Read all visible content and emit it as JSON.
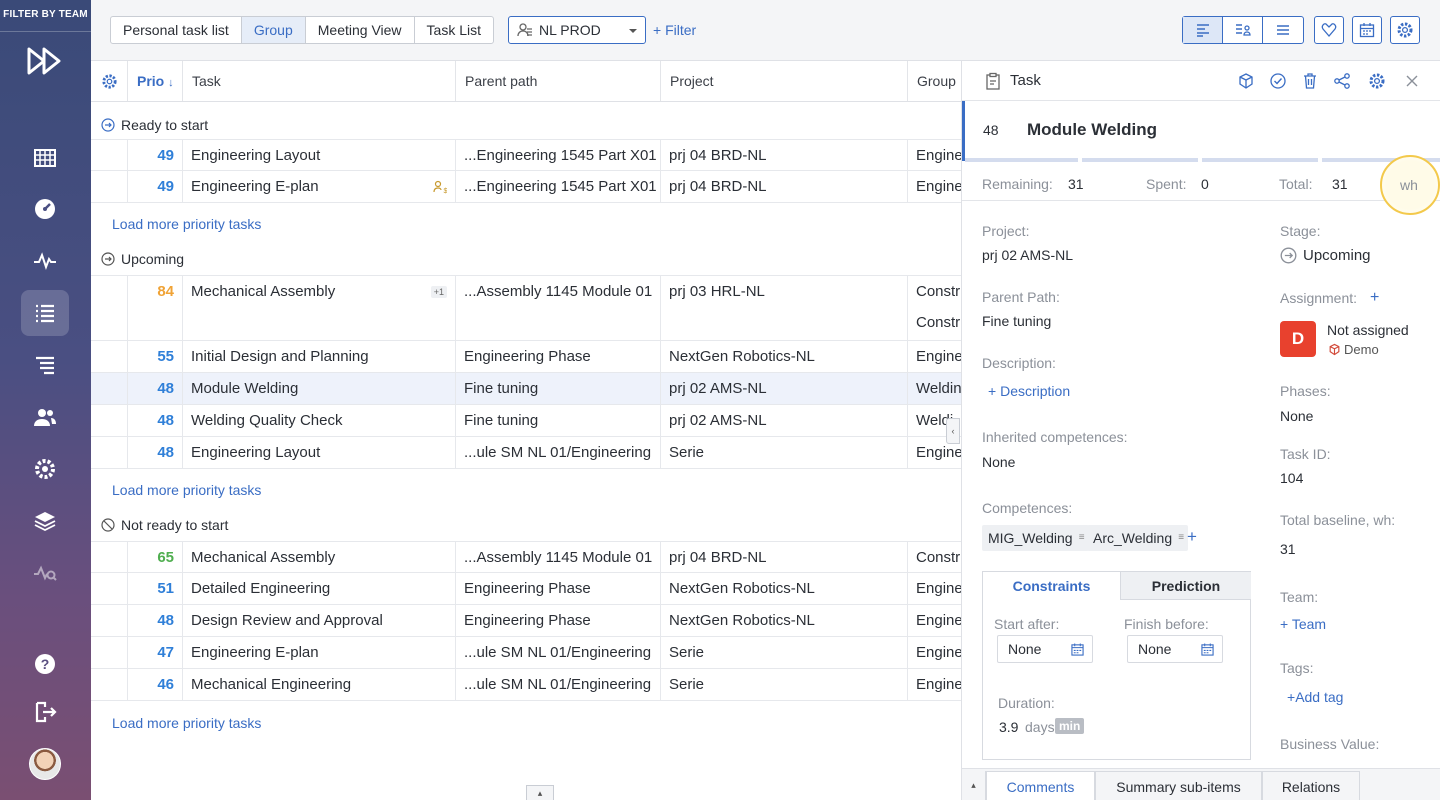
{
  "sidebar": {
    "filter_label": "FILTER BY TEAM"
  },
  "topbar": {
    "views": [
      "Personal task list",
      "Group",
      "Meeting View",
      "Task List"
    ],
    "active_view": "Group",
    "env_select": "NL PROD",
    "filter_label": "Filter"
  },
  "grid": {
    "columns": {
      "prio": "Prio",
      "task": "Task",
      "parent": "Parent path",
      "project": "Project",
      "group": "Group"
    },
    "groups": [
      {
        "label": "Ready to start"
      },
      {
        "label": "Upcoming"
      },
      {
        "label": "Not ready to start"
      }
    ],
    "load_more": "Load more priority tasks",
    "rows": [
      {
        "prio": "49",
        "task": "Engineering Layout",
        "parent": "...Engineering 1545 Part X01",
        "project": "prj 04 BRD-NL",
        "group": "Engine"
      },
      {
        "prio": "49",
        "task": "Engineering E-plan",
        "parent": "...Engineering 1545 Part X01",
        "project": "prj 04 BRD-NL",
        "group": "Engine"
      },
      {
        "prio": "84",
        "task": "Mechanical Assembly",
        "parent": "...Assembly 1145 Module 01",
        "project": "prj 03 HRL-NL",
        "group": "Constr",
        "group2": "Constr",
        "badge": "+1"
      },
      {
        "prio": "55",
        "task": "Initial Design and Planning",
        "parent": "Engineering Phase",
        "project": "NextGen Robotics-NL",
        "group": "Engine"
      },
      {
        "prio": "48",
        "task": "Module Welding",
        "parent": "Fine tuning",
        "project": "prj 02 AMS-NL",
        "group": "Weldin"
      },
      {
        "prio": "48",
        "task": "Welding Quality Check",
        "parent": "Fine tuning",
        "project": "prj 02 AMS-NL",
        "group": "Weldi"
      },
      {
        "prio": "48",
        "task": "Engineering Layout",
        "parent": " ...ule SM NL 01/Engineering",
        "project": "Serie",
        "group": "Engine"
      },
      {
        "prio": "65",
        "task": "Mechanical Assembly",
        "parent": "...Assembly 1145 Module 01",
        "project": "prj 04 BRD-NL",
        "group": "Constr"
      },
      {
        "prio": "51",
        "task": "Detailed Engineering",
        "parent": "Engineering Phase",
        "project": "NextGen Robotics-NL",
        "group": "Engine"
      },
      {
        "prio": "48",
        "task": "Design Review and Approval",
        "parent": "Engineering Phase",
        "project": "NextGen Robotics-NL",
        "group": "Engine"
      },
      {
        "prio": "47",
        "task": "Engineering E-plan",
        "parent": " ...ule SM NL 01/Engineering",
        "project": "Serie",
        "group": "Engine"
      },
      {
        "prio": "46",
        "task": "Mechanical Engineering",
        "parent": " ...ule SM NL 01/Engineering",
        "project": "Serie",
        "group": "Engine"
      }
    ],
    "prio_colors": {
      "blue": "#2f7fd8",
      "orange": "#f0a336",
      "green": "#4fae4f"
    }
  },
  "panel": {
    "header": "Task",
    "task_number": "48",
    "task_name": "Module Welding",
    "stats": {
      "remaining_label": "Remaining:",
      "remaining": "31",
      "spent_label": "Spent:",
      "spent": "0",
      "total_label": "Total:",
      "total": "31",
      "unit": "wh"
    },
    "project_label": "Project:",
    "project": "prj 02 AMS-NL",
    "parent_label": "Parent Path:",
    "parent": "Fine tuning",
    "description_label": "Description:",
    "description_link": "Description",
    "inherited_label": "Inherited competences:",
    "inherited": "None",
    "competences_label": "Competences:",
    "competences": [
      "MIG_Welding",
      "Arc_Welding"
    ],
    "stage_label": "Stage:",
    "stage": "Upcoming",
    "assignment_label": "Assignment:",
    "assignee_initial": "D",
    "assignee": "Not assigned",
    "assignee_team": "Demo",
    "phases_label": "Phases:",
    "phases": "None",
    "taskid_label": "Task ID:",
    "taskid": "104",
    "baseline_label": "Total baseline, wh:",
    "baseline": "31",
    "team_label": "Team:",
    "team_link": "Team",
    "tags_label": "Tags:",
    "tags_link": "Add tag",
    "bv_label": "Business Value:",
    "constraints": {
      "tab_constraints": "Constraints",
      "tab_prediction": "Prediction",
      "start_label": "Start after:",
      "start": "None",
      "finish_label": "Finish before:",
      "finish": "None",
      "duration_label": "Duration:",
      "duration": "3.9",
      "duration_unit": "days",
      "duration_badge": "min"
    },
    "bottom_tabs": [
      "Comments",
      "Summary sub-items",
      "Relations"
    ]
  }
}
